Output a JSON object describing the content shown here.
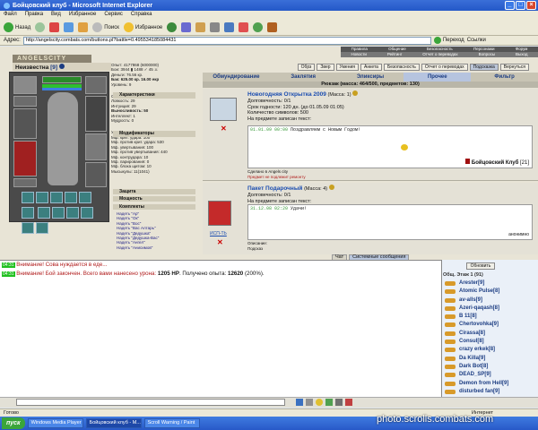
{
  "window": {
    "title": "Бойцовский клуб - Microsoft Internet Explorer"
  },
  "menu": [
    "Файл",
    "Правка",
    "Вид",
    "Избранное",
    "Сервис",
    "Справка"
  ],
  "toolbar": {
    "back": "Назад",
    "search": "Поиск",
    "favorites": "Избранное"
  },
  "address": {
    "label": "Адрес:",
    "url": "http://angelscity.combats.com/buttons.pl?battle=0.495534185084431",
    "go": "Переход",
    "links": "Ссылки"
  },
  "topnav": {
    "row1": [
      "Правила",
      "Общение",
      "Безопасность",
      "Персонажи",
      "Форум"
    ],
    "row2": [
      "Новости",
      "Рейтинг",
      "Отчет о переводах",
      "Вопросы",
      "Выход"
    ]
  },
  "game": {
    "logo": "ANGELSCITY",
    "character": {
      "name": "Неизвестна",
      "level": "[9]"
    },
    "stats": [
      "Опыт: 4177868 (6000000)",
      "Бои: 3944 ▮ 1488 ✓ 45 ⚔",
      "Деньги: 76.56 кр.",
      "Бак: 625.00 кр. 16.00 екр",
      "Уровень: 9"
    ],
    "sections": {
      "chars": "Характеристики",
      "mods": "Модификаторы",
      "protection": "Защита",
      "features": "Мощность",
      "sets": "Комплекты"
    },
    "attributes": [
      "Сила: 114",
      "Ловкость: 29",
      "Интуиция: 29",
      "Выносливость: 50",
      "Интеллект: 1",
      "Мудрость: 0"
    ],
    "modifiers": [
      "Урон: 211-257",
      "Мф. крит. удара: 100",
      "Мф. против крит. удара: 530",
      "Мф. увертывания: 100",
      "Мф. против увертывания: 440",
      "Мф. контрудара: 10",
      "Мф. парирования: 0",
      "Мф. блока щитом: 10",
      "Мысыкулы: 11(1041)"
    ],
    "sets": [
      "Надеть \"Ар\"",
      "Надеть \"Ок\"",
      "Надеть \"Вос\"",
      "Надеть \"Вас Алтарь\"",
      "Надеть \"Дедушка\"",
      "Надеть \"Дедушка-Вас\"",
      "Надеть \"Ангел\"",
      "Надеть \"Анисимов\""
    ],
    "cmd_buttons": [
      "Обрз",
      "Звер",
      "Умения",
      "Анкета",
      "Безопасность",
      "Отчет о переводах",
      "Подсказка",
      "Вернуться"
    ],
    "tabs": [
      "Обмундирование",
      "Заклятия",
      "Эликсиры",
      "Прочее",
      "Фильтр"
    ],
    "active_tab": "Прочее",
    "mass_info": "Рюкзак (масса: 464/500, предметов: 130)",
    "item1": {
      "name": "Новогодняя Открытка 2009",
      "mass": "(Масса: 1)",
      "lines": [
        "Долговечность: 0/1",
        "Срок годности: 120 дн. (до 01.05.09 01:05)",
        "Количество символов: 500",
        "На предмете записан текст:"
      ],
      "msg_date": "01.01.09 00:00",
      "msg_text": "Поздравляем с Новым Годом!",
      "sender": "Бойцовский Клуб",
      "sender_level": "[21]",
      "made_in": "Сделано в Angels city",
      "sell": "Предмет не подлежит ремонту"
    },
    "item2": {
      "name": "Пакет Подарочный",
      "mass": "(Масса: 4)",
      "lines": [
        "Долговечность: 0/1",
        "На предмете записан текст:"
      ],
      "msg_date": "31.12.08 02:20",
      "msg_text": "Удачи!",
      "caption": "ИСП-ТЬ",
      "anon": "анонимно",
      "desc": "Описание:",
      "desc2": "Подсказ"
    }
  },
  "chat": {
    "tabs": [
      "Чат",
      "Системные сообщения"
    ],
    "lines": [
      {
        "time": "04:31",
        "text": "Внимание! Сова нуждается в еде..."
      },
      {
        "time": "04:31",
        "text_pre": "Внимание! Бой закончен. Всего вами нанесено урона: ",
        "dmg": "1205 HP",
        "text_mid": ". Получено опыта: ",
        "exp": "12620",
        "text_post": " (200%)."
      }
    ]
  },
  "people": {
    "refresh": "Обновить",
    "room": "Общ. Этаж 1 (91)",
    "list": [
      "Arester[9]",
      "Atomic Pulse[8]",
      "av-alls[9]",
      "Azeri-qaqash[8]",
      "B 11[8]",
      "Chertovohka[9]",
      "Cirassa[8]",
      "Consul[8]",
      "crazy erkek[8]",
      "Da Killa[9]",
      "Dark Bot[8]",
      "DEAD_SP[9]",
      "Demon from Hell[9]",
      "disturbed fan[9]"
    ]
  },
  "statusbar": {
    "left": "Готово",
    "zone": "Интернет"
  },
  "taskbar": {
    "start": "пуск",
    "tasks": [
      "Windows Media Player",
      "Бойцовский клуб - M...",
      "Scroll Warning / Paint"
    ],
    "watermark": "photo.scrolls.combats.com"
  }
}
